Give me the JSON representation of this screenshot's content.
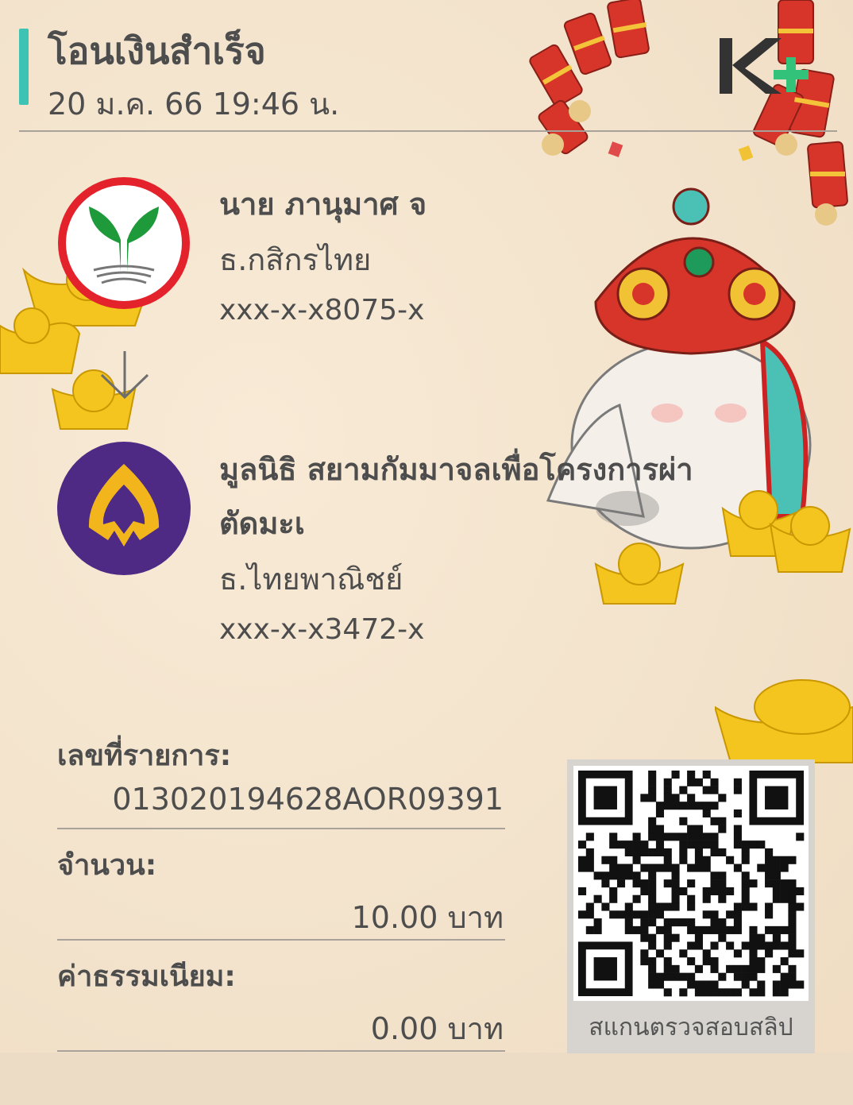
{
  "header": {
    "title": "โอนเงินสำเร็จ",
    "datetime": "20 ม.ค. 66  19:46 น.",
    "logo_icon": "kplus-logo-icon"
  },
  "sender": {
    "name": "นาย ภานุมาศ จ",
    "bank": "ธ.กสิกรไทย",
    "account": "xxx-x-x8075-x",
    "logo_icon": "kasikornbank-logo-icon"
  },
  "receiver": {
    "name_line1": "มูลนิธิ สยามกัมมาจลเพื่อโครงการผ่า",
    "name_line2": "ตัดมะเ",
    "bank": "ธ.ไทยพาณิชย์",
    "account": "xxx-x-x3472-x",
    "logo_icon": "scb-logo-icon"
  },
  "details": {
    "ref_label": "เลขที่รายการ:",
    "ref_value": "013020194628AOR09391",
    "amount_label": "จำนวน:",
    "amount_value": "10.00 บาท",
    "fee_label": "ค่าธรรมเนียม:",
    "fee_value": "0.00 บาท"
  },
  "qr": {
    "caption": "สแกนตรวจสอบสลิป",
    "icon": "qr-code-icon"
  },
  "colors": {
    "accent": "#3cc3b3",
    "kbank_green": "#1f9a3a",
    "kbank_red": "#e3222b",
    "scb_purple": "#4e2a84",
    "scb_gold": "#f2b61c"
  }
}
